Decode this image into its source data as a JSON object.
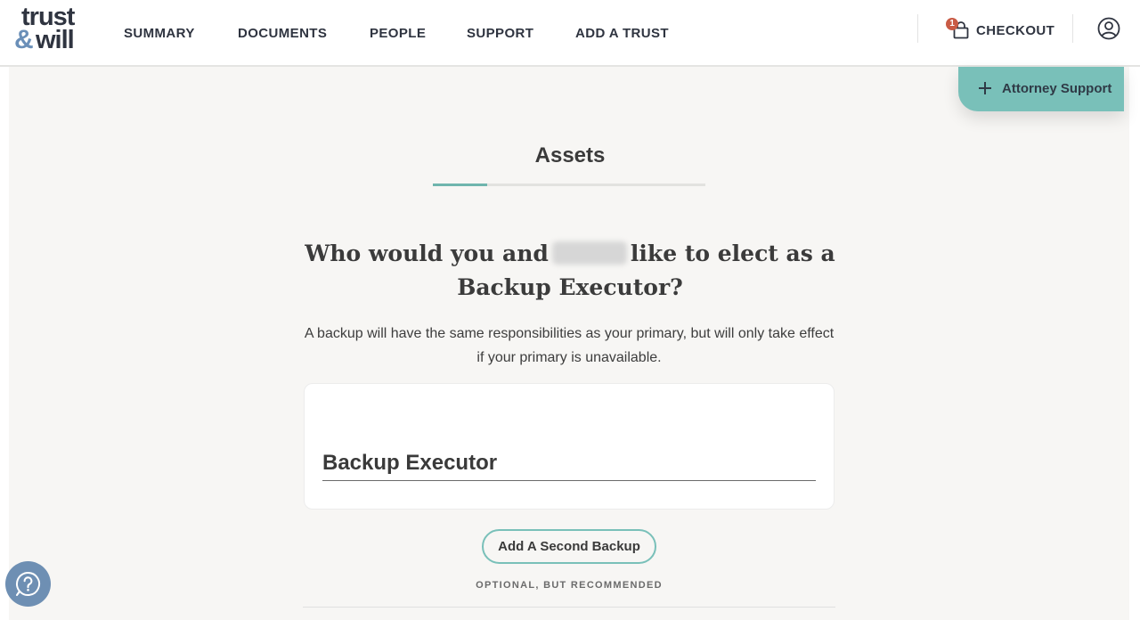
{
  "brand": {
    "logo_line1": "trust",
    "logo_amp": "&",
    "logo_line2": "will",
    "accent_color": "#79c0b9",
    "badge_color": "#c95b45"
  },
  "nav": {
    "items": [
      "SUMMARY",
      "DOCUMENTS",
      "PEOPLE",
      "SUPPORT",
      "ADD A TRUST"
    ],
    "checkout_label": "CHECKOUT",
    "checkout_count": "1",
    "checkout_icon": "shopping-bag-icon",
    "account_icon": "user-account-icon"
  },
  "attorney_support": {
    "label": "Attorney Support",
    "icon": "plus-icon"
  },
  "section": {
    "title": "Assets",
    "progress_fraction": 0.2
  },
  "question": {
    "line_start": "Who would you and",
    "line_end": "like to elect as a Backup Executor?"
  },
  "subtext": "A backup will have the same responsibilities as your primary, but will only take effect if your primary is unavailable.",
  "card": {
    "field_label": "Backup Executor"
  },
  "second_backup": {
    "button_label": "Add A Second Backup",
    "note": "OPTIONAL, BUT RECOMMENDED"
  },
  "help": {
    "icon": "help-question-icon"
  }
}
